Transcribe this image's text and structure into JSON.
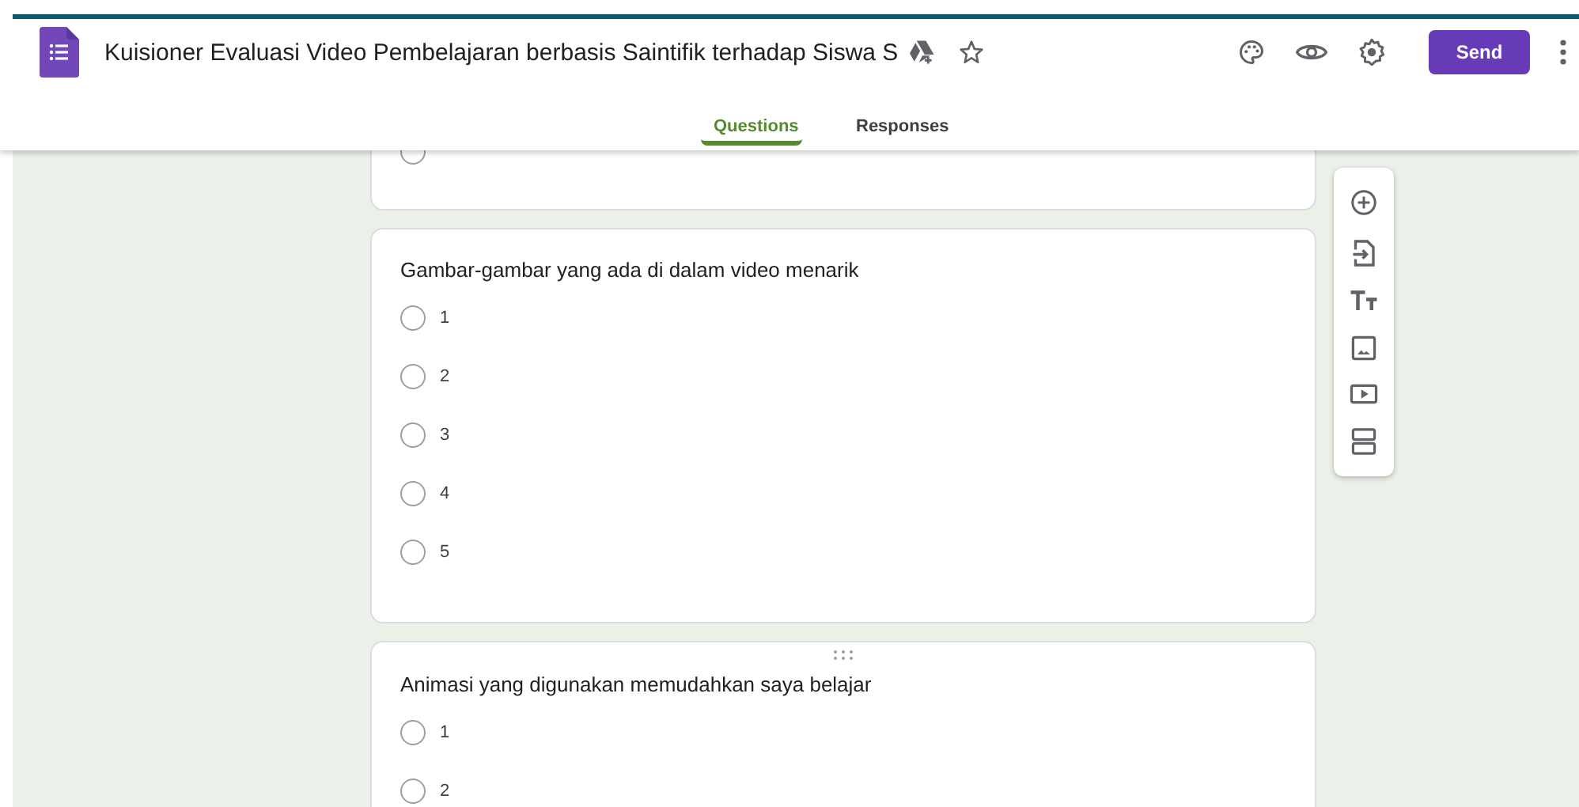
{
  "header": {
    "title": "Kuisioner Evaluasi Video Pembelajaran berbasis Saintifik terhadap Siswa S",
    "send": "Send"
  },
  "tabs": [
    {
      "label": "Questions",
      "selected": true
    },
    {
      "label": "Responses",
      "selected": false
    }
  ],
  "cut_question": {
    "options": [
      {
        "selected": false
      }
    ]
  },
  "questions": [
    {
      "title": "Gambar-gambar yang ada di dalam video menarik",
      "drag_handle": false,
      "options": [
        {
          "label": "1",
          "selected": false
        },
        {
          "label": "2",
          "selected": false
        },
        {
          "label": "3",
          "selected": false
        },
        {
          "label": "4",
          "selected": false
        },
        {
          "label": "5",
          "selected": false
        }
      ]
    },
    {
      "title": "Animasi yang digunakan memudahkan saya belajar",
      "drag_handle": true,
      "options": [
        {
          "label": "1",
          "selected": false
        },
        {
          "label": "2",
          "selected": false
        }
      ]
    }
  ]
}
